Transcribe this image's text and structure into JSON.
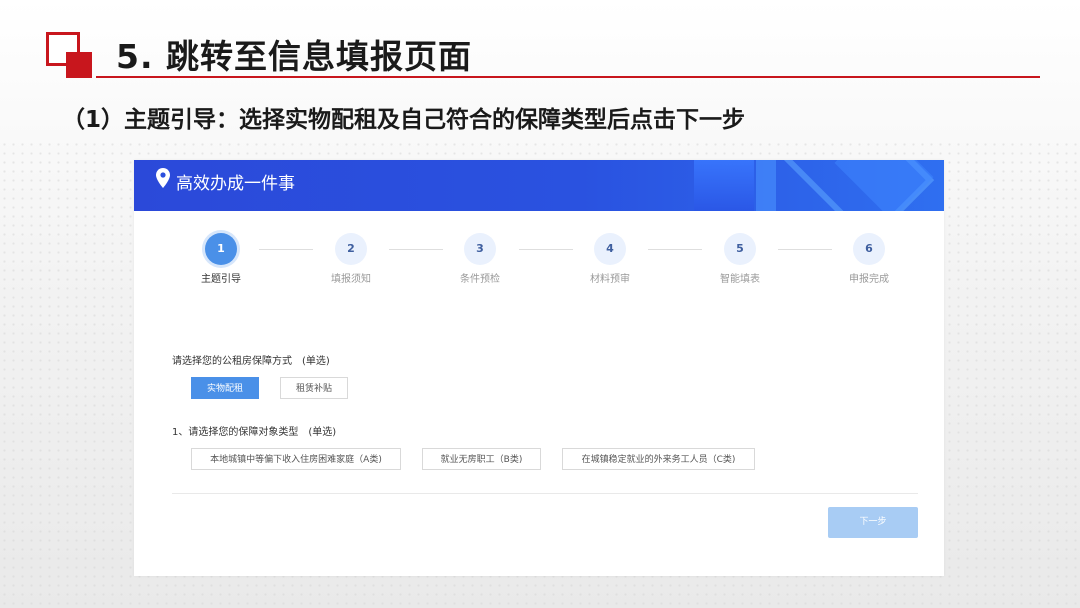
{
  "slide": {
    "title": "5. 跳转至信息填报页面",
    "subtitle": "（1）主题引导：选择实物配租及自己符合的保障类型后点击下一步",
    "accent_color": "#c8161d"
  },
  "app": {
    "header_title": "高效办成一件事",
    "header_icon": "location-pin-icon",
    "header_color": "#2a52e0",
    "steps": [
      {
        "num": "1",
        "label": "主题引导",
        "active": true
      },
      {
        "num": "2",
        "label": "填报须知",
        "active": false
      },
      {
        "num": "3",
        "label": "条件预检",
        "active": false
      },
      {
        "num": "4",
        "label": "材料预审",
        "active": false
      },
      {
        "num": "5",
        "label": "智能填表",
        "active": false
      },
      {
        "num": "6",
        "label": "申报完成",
        "active": false
      }
    ],
    "question1": {
      "label": "请选择您的公租房保障方式　(单选)",
      "options": [
        "实物配租",
        "租赁补贴"
      ],
      "selected": "实物配租"
    },
    "question2": {
      "label": "1、请选择您的保障对象类型　(单选)",
      "options": [
        "本地城镇中等偏下收入住房困难家庭（A类)",
        "就业无房职工（B类)",
        "在城镇稳定就业的外来务工人员（C类)"
      ]
    },
    "next_button": "下一步",
    "accent_color": "#4a90e8"
  }
}
